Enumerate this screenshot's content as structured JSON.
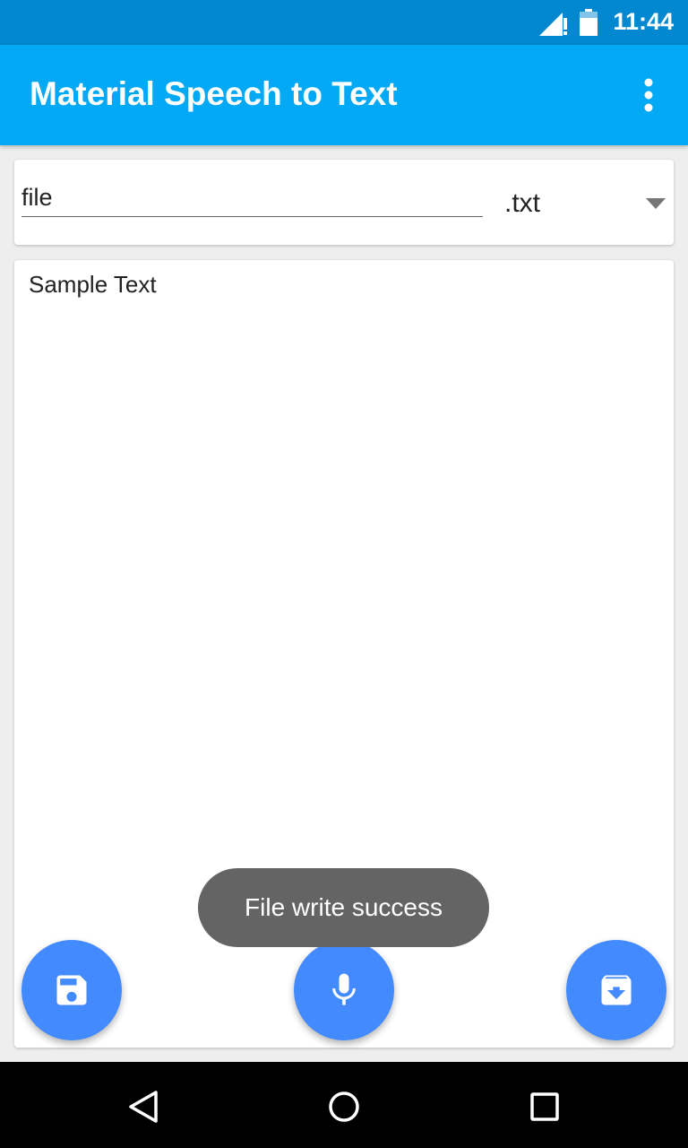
{
  "status_bar": {
    "time": "11:44",
    "icons": [
      "signal-icon",
      "battery-icon"
    ]
  },
  "app_bar": {
    "title": "Material Speech to Text",
    "menu_icon": "more-vert-icon"
  },
  "filename": {
    "value": "file",
    "extension": ".txt",
    "dropdown_icon": "arrow-drop-down-icon"
  },
  "editor": {
    "text": "Sample Text"
  },
  "toast": {
    "message": "File write success"
  },
  "fabs": {
    "save_icon": "save-icon",
    "mic_icon": "mic-icon",
    "archive_icon": "archive-icon"
  },
  "nav_bar": {
    "icons": [
      "back-icon",
      "home-icon",
      "recents-icon"
    ]
  },
  "colors": {
    "status_bar": "#0288d1",
    "app_bar": "#03a9f4",
    "fab": "#448aff",
    "toast": "#646464",
    "background": "#eeeeee"
  }
}
